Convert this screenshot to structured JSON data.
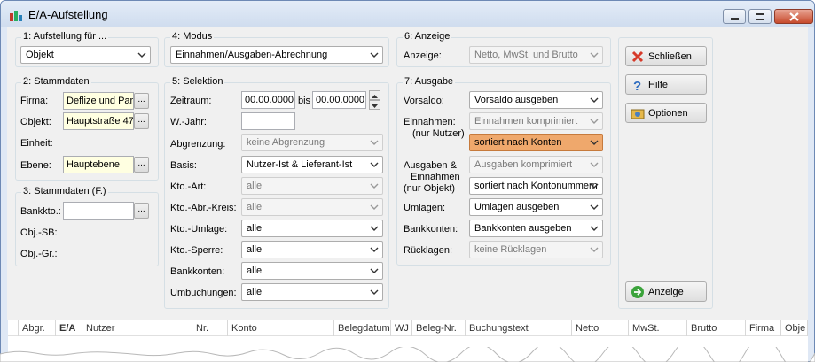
{
  "window": {
    "title": "E/A-Aufstellung"
  },
  "groups": {
    "aufstellung": {
      "label": "1: Aufstellung für ...",
      "value": "Objekt"
    },
    "stammdaten": {
      "label": "2: Stammdaten",
      "firma_label": "Firma:",
      "firma_value": "Deflize und Par",
      "objekt_label": "Objekt:",
      "objekt_value": "Hauptstraße 47",
      "einheit_label": "Einheit:",
      "ebene_label": "Ebene:",
      "ebene_value": "Hauptebene"
    },
    "stammdaten_f": {
      "label": "3: Stammdaten (F.)",
      "bankkto_label": "Bankkto.:",
      "bankkto_value": "",
      "objsb_label": "Obj.-SB:",
      "objgr_label": "Obj.-Gr.:"
    },
    "modus": {
      "label": "4: Modus",
      "value": "Einnahmen/Ausgaben-Abrechnung"
    },
    "selektion": {
      "label": "5: Selektion",
      "zeitraum_label": "Zeitraum:",
      "zeitraum_from": "00.00.0000",
      "bis": "bis",
      "zeitraum_to": "00.00.0000",
      "wjahr_label": "W.-Jahr:",
      "wjahr_value": "",
      "abgrenzung_label": "Abgrenzung:",
      "abgrenzung_value": "keine Abgrenzung",
      "basis_label": "Basis:",
      "basis_value": "Nutzer-Ist & Lieferant-Ist",
      "ktoart_label": "Kto.-Art:",
      "ktoart_value": "alle",
      "ktoabr_label": "Kto.-Abr.-Kreis:",
      "ktoabr_value": "alle",
      "ktoumlage_label": "Kto.-Umlage:",
      "ktoumlage_value": "alle",
      "ktosperre_label": "Kto.-Sperre:",
      "ktosperre_value": "alle",
      "bankkonten_label": "Bankkonten:",
      "bankkonten_value": "alle",
      "umbuchungen_label": "Umbuchungen:",
      "umbuchungen_value": "alle"
    },
    "anzeige": {
      "label": "6: Anzeige",
      "anzeige_label": "Anzeige:",
      "anzeige_value": "Netto, MwSt. und Brutto"
    },
    "ausgabe": {
      "label": "7: Ausgabe",
      "vorsaldo_label": "Vorsaldo:",
      "vorsaldo_value": "Vorsaldo ausgeben",
      "einnahmen_label": "Einnahmen:",
      "einnahmen_sub": "(nur Nutzer)",
      "einnahmen_value1": "Einnahmen komprimiert",
      "einnahmen_value2": "sortiert nach Konten",
      "ausgaben_label1": "Ausgaben &",
      "ausgaben_label2": "Einnahmen",
      "ausgaben_label3": "(nur Objekt)",
      "ausgaben_value1": "Ausgaben komprimiert",
      "ausgaben_value2": "sortiert nach Kontonummern",
      "umlagen_label": "Umlagen:",
      "umlagen_value": "Umlagen ausgeben",
      "bankkonten_label": "Bankkonten:",
      "bankkonten_value": "Bankkonten ausgeben",
      "ruecklagen_label": "Rücklagen:",
      "ruecklagen_value": "keine Rücklagen"
    }
  },
  "buttons": {
    "schliessen": "Schließen",
    "hilfe": "Hilfe",
    "optionen": "Optionen",
    "anzeige": "Anzeige"
  },
  "table": {
    "columns": [
      "Abgr.",
      "E/A",
      "Nutzer",
      "Nr.",
      "Konto",
      "Belegdatum",
      "WJ",
      "Beleg-Nr.",
      "Buchungstext",
      "Netto",
      "MwSt.",
      "Brutto",
      "Firma",
      "Obje"
    ]
  },
  "colors": {
    "highlight": "#efa86c",
    "input_yellow": "#ffffe1",
    "frame": "#dfe8f5"
  }
}
